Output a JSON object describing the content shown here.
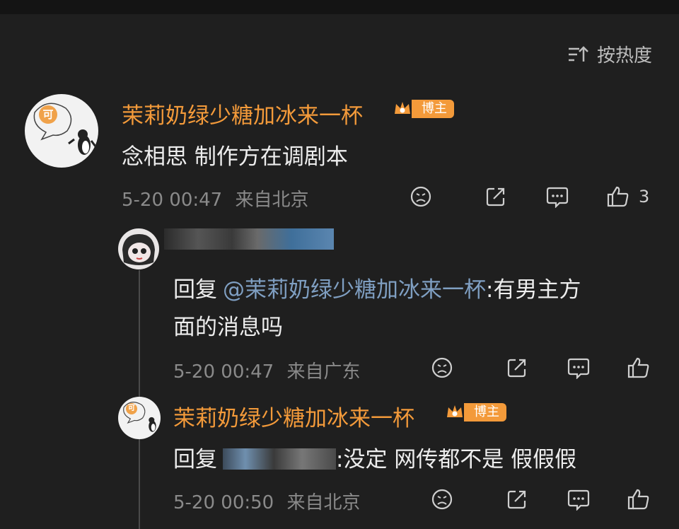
{
  "header": {
    "sort_label": "按热度",
    "sort_icon": "sort-icon"
  },
  "comment": {
    "avatar_text": "可",
    "author": "茉莉奶绿少糖加冰来一杯",
    "badge": "博主",
    "text": "念相思 制作方在调剧本",
    "time": "5-20 00:47",
    "location": "来自北京",
    "likes": "3",
    "icons": [
      "dislike-icon",
      "share-icon",
      "comment-icon",
      "like-icon"
    ]
  },
  "replies": [
    {
      "author_blurred": true,
      "prefix": "回复",
      "mention": "@茉莉奶绿少糖加冰来一杯",
      "line1_rest": ":有男主方",
      "line2": "面的消息吗",
      "time": "5-20 00:47",
      "location": "来自广东"
    },
    {
      "avatar_text": "可",
      "author": "茉莉奶绿少糖加冰来一杯",
      "badge": "博主",
      "prefix": "回复",
      "text_rest": ":没定 网传都不是 假假假",
      "time": "5-20 00:50",
      "location": "来自北京"
    }
  ],
  "colors": {
    "accent": "#f39a3a",
    "mention": "#7f9fc2",
    "background": "#1f1f1f"
  }
}
